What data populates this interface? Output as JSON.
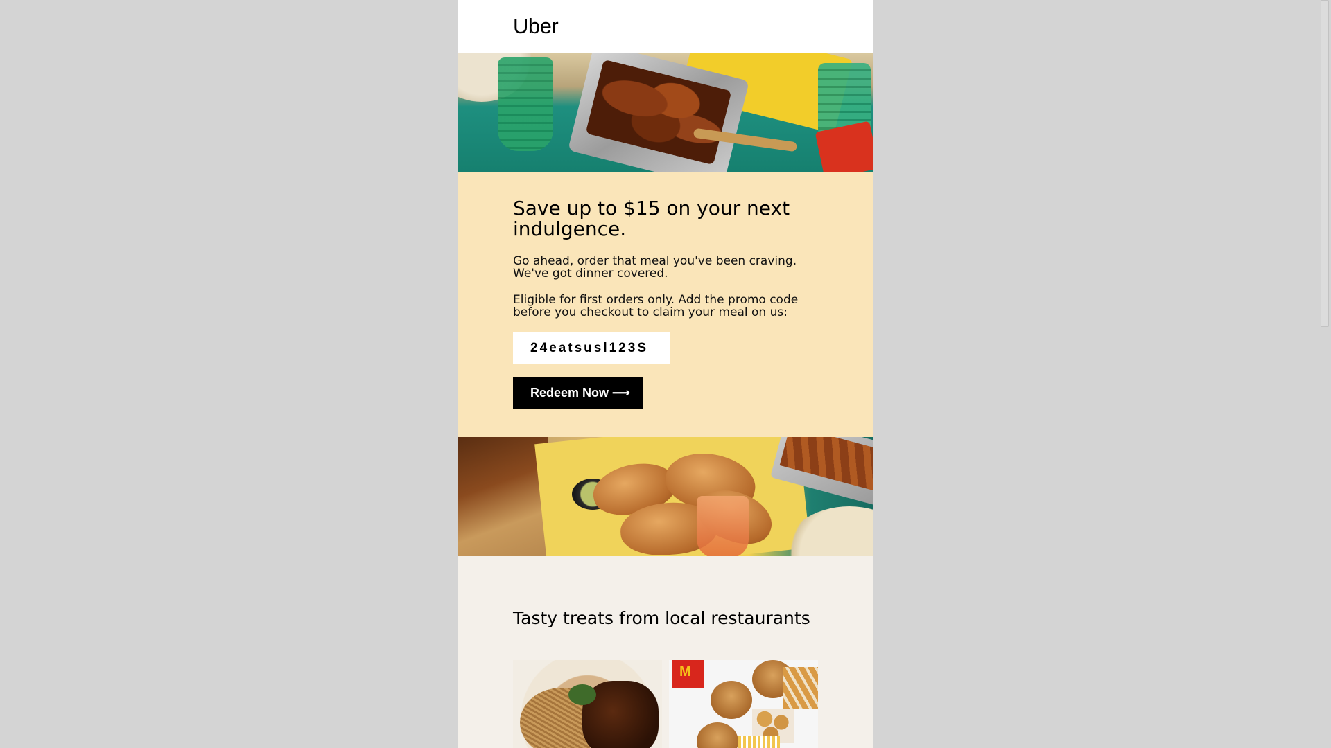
{
  "brand": {
    "logo_text": "Uber"
  },
  "promo": {
    "headline": "Save up to $15 on your next indulgence.",
    "paragraph1": "Go ahead, order that meal you've been craving. We've got dinner covered.",
    "paragraph2": "Eligible for first orders only. Add the promo code before you checkout to claim your meal on us:",
    "promo_code": "24eatsusl123S",
    "cta_label": "Redeem Now ⟶"
  },
  "treats": {
    "title": "Tasty treats from local restaurants",
    "cards": [
      {
        "name": "noodles-and-meat"
      },
      {
        "name": "mcdonalds-meal"
      }
    ]
  },
  "colors": {
    "page_bg": "#d4d4d4",
    "promo_bg": "#fae5b9",
    "treats_bg": "#f4f0ea",
    "cta_bg": "#000000",
    "cta_text": "#ffffff"
  }
}
